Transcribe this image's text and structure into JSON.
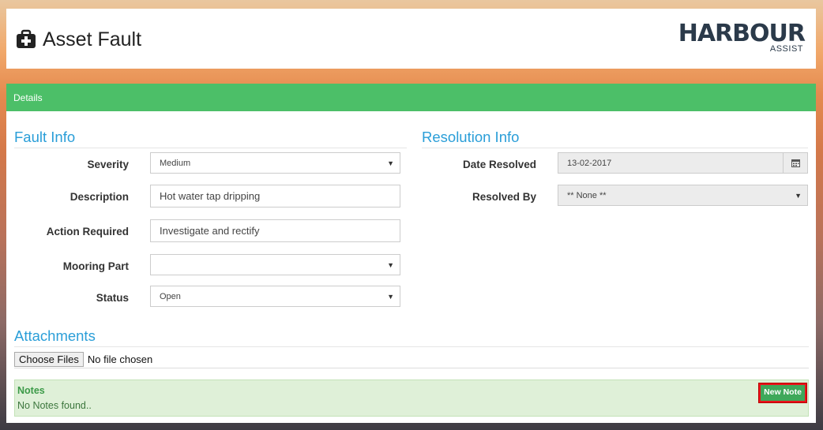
{
  "header": {
    "title": "Asset Fault",
    "title_icon": "medical-kit-icon",
    "logo_main": "HARBOUR",
    "logo_sub": "ASSIST"
  },
  "panel": {
    "heading": "Details"
  },
  "fault_info": {
    "title": "Fault Info",
    "severity": {
      "label": "Severity",
      "value": "Medium"
    },
    "description": {
      "label": "Description",
      "value": "Hot water tap dripping"
    },
    "action_required": {
      "label": "Action Required",
      "value": "Investigate and rectify"
    },
    "mooring_part": {
      "label": "Mooring Part",
      "value": ""
    },
    "status": {
      "label": "Status",
      "value": "Open"
    }
  },
  "resolution_info": {
    "title": "Resolution Info",
    "date_resolved": {
      "label": "Date Resolved",
      "value": "13-02-2017",
      "icon": "calendar-icon"
    },
    "resolved_by": {
      "label": "Resolved By",
      "value": "** None **"
    }
  },
  "attachments": {
    "title": "Attachments",
    "choose_files": "Choose Files",
    "no_file": "No file chosen"
  },
  "notes": {
    "title": "Notes",
    "empty_text": "No Notes found..",
    "new_note_button": "New Note"
  },
  "colors": {
    "panel_heading": "#4cbf68",
    "section_title": "#2a9ed8",
    "notes_bg": "#dff0d8",
    "highlight_border": "#e8131b"
  }
}
